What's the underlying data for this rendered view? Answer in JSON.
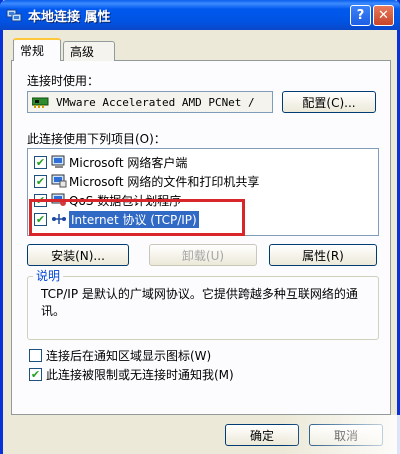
{
  "window": {
    "title": "本地连接 属性",
    "help_glyph": "?",
    "close_glyph": "✕",
    "icon": "network-connection-icon"
  },
  "tabs": [
    {
      "label": "常规",
      "active": true
    },
    {
      "label": "高级",
      "active": false
    }
  ],
  "connect_using": {
    "label": "连接时使用：",
    "adapter": "VMware Accelerated AMD PCNet /",
    "configure_label": "配置(C)..."
  },
  "components": {
    "label": "此连接使用下列项目(O)：",
    "items": [
      {
        "label": "Microsoft 网络客户端",
        "checked": true,
        "icon": "network-client-icon"
      },
      {
        "label": "Microsoft 网络的文件和打印机共享",
        "checked": true,
        "icon": "file-printer-sharing-icon"
      },
      {
        "label": "QoS 数据包计划程序",
        "checked": true,
        "icon": "qos-scheduler-icon"
      },
      {
        "label": "Internet 协议 (TCP/IP)",
        "checked": true,
        "selected": true,
        "icon": "protocol-icon"
      }
    ],
    "highlight_color": "#d9262b"
  },
  "actions": {
    "install_label": "安装(N)...",
    "uninstall_label": "卸载(U)",
    "properties_label": "属性(R)"
  },
  "description": {
    "legend": "说明",
    "text": "TCP/IP 是默认的广域网协议。它提供跨越多种互联网络的通讯。"
  },
  "options": [
    {
      "label": "连接后在通知区域显示图标(W)",
      "checked": false
    },
    {
      "label": "此连接被限制或无连接时通知我(M)",
      "checked": true
    }
  ],
  "footer": {
    "ok_label": "确定",
    "cancel_label": "取消"
  },
  "colors": {
    "titlebar": "#0054e3",
    "selection": "#316ac5",
    "face": "#ece9d8"
  }
}
